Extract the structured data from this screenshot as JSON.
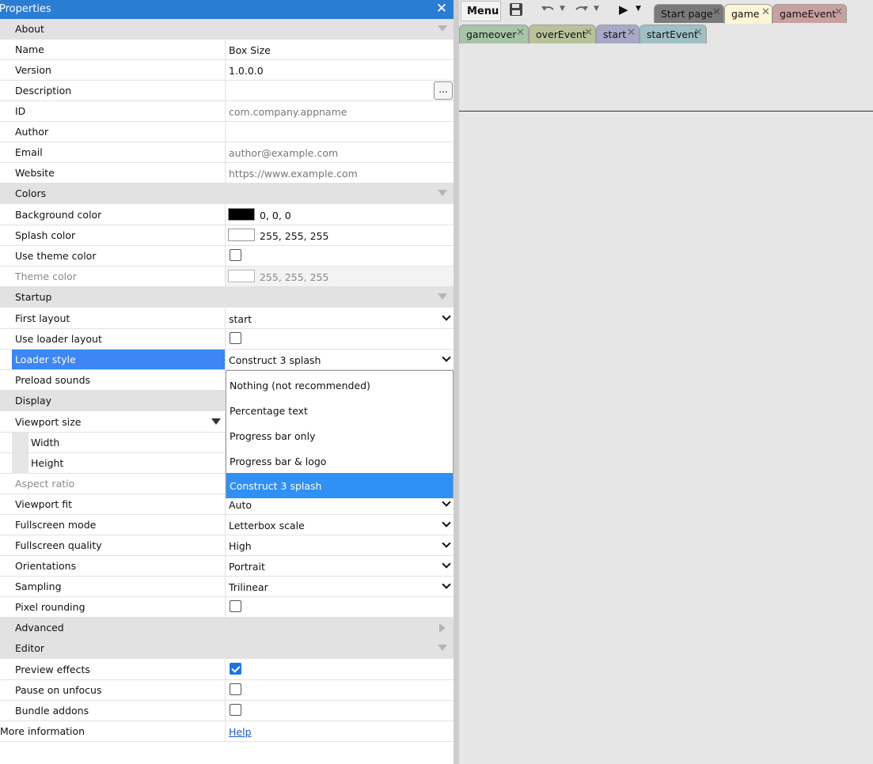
{
  "panel": {
    "title": "Properties",
    "close_icon": "close-icon",
    "groups": {
      "about": "About",
      "colors": "Colors",
      "startup": "Startup",
      "display": "Display",
      "advanced": "Advanced",
      "editor": "Editor"
    },
    "about": {
      "name_label": "Name",
      "name_value": "Box Size",
      "version_label": "Version",
      "version_value": "1.0.0.0",
      "description_label": "Description",
      "description_button": "...",
      "id_label": "ID",
      "id_placeholder": "com.company.appname",
      "author_label": "Author",
      "email_label": "Email",
      "email_placeholder": "author@example.com",
      "website_label": "Website",
      "website_placeholder": "https://www.example.com"
    },
    "colors": {
      "background_label": "Background color",
      "background_value": "0, 0, 0",
      "background_swatch": "#000000",
      "splash_label": "Splash color",
      "splash_value": "255, 255, 255",
      "splash_swatch": "#ffffff",
      "use_theme_label": "Use theme color",
      "use_theme_checked": false,
      "theme_label": "Theme color",
      "theme_value": "255, 255, 255",
      "theme_swatch": "#ffffff"
    },
    "startup": {
      "first_layout_label": "First layout",
      "first_layout_value": "start",
      "use_loader_label": "Use loader layout",
      "use_loader_checked": false,
      "loader_style_label": "Loader style",
      "loader_style_value": "Construct 3 splash",
      "preload_sounds_label": "Preload sounds"
    },
    "loader_style_options": [
      "Nothing (not recommended)",
      "Percentage text",
      "Progress bar only",
      "Progress bar & logo",
      "Construct 3 splash"
    ],
    "display": {
      "viewport_size_label": "Viewport size",
      "width_label": "Width",
      "height_label": "Height",
      "aspect_ratio_label": "Aspect ratio",
      "viewport_fit_label": "Viewport fit",
      "viewport_fit_value": "Auto",
      "fullscreen_mode_label": "Fullscreen mode",
      "fullscreen_mode_value": "Letterbox scale",
      "fullscreen_quality_label": "Fullscreen quality",
      "fullscreen_quality_value": "High",
      "orientations_label": "Orientations",
      "orientations_value": "Portrait",
      "sampling_label": "Sampling",
      "sampling_value": "Trilinear",
      "pixel_rounding_label": "Pixel rounding",
      "pixel_rounding_checked": false
    },
    "editor": {
      "preview_effects_label": "Preview effects",
      "preview_effects_checked": true,
      "pause_unfocus_label": "Pause on unfocus",
      "pause_unfocus_checked": false,
      "bundle_addons_label": "Bundle addons",
      "bundle_addons_checked": false
    },
    "more_info_label": "More information",
    "help_link": "Help"
  },
  "toolbar": {
    "menu_label": "Menu",
    "icons": [
      "save-icon",
      "undo-icon",
      "redo-icon",
      "play-icon"
    ]
  },
  "tabs_row1": [
    {
      "label": "Start page",
      "color": "#7a7a7a"
    },
    {
      "label": "game",
      "color": "#fdf5d3"
    },
    {
      "label": "gameEvent",
      "color": "#c9a0a0"
    }
  ],
  "tabs_row2": [
    {
      "label": "gameover",
      "color": "#a6c4a6"
    },
    {
      "label": "overEvent",
      "color": "#b9c29a"
    },
    {
      "label": "start",
      "color": "#a8a8c8"
    },
    {
      "label": "startEvent",
      "color": "#9fc0c4"
    }
  ]
}
